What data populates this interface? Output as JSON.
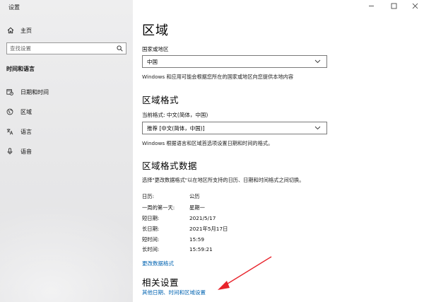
{
  "window": {
    "title": "设置",
    "controls": {
      "minimize": "—",
      "maximize": "□",
      "close": "✕"
    }
  },
  "sidebar": {
    "home_label": "主页",
    "search_placeholder": "查找设置",
    "section_title": "时间和语言",
    "items": [
      {
        "label": "日期和时间",
        "icon": "calendar-clock-icon"
      },
      {
        "label": "区域",
        "icon": "globe-icon",
        "active": true
      },
      {
        "label": "语言",
        "icon": "language-icon"
      },
      {
        "label": "语音",
        "icon": "microphone-icon"
      }
    ]
  },
  "main": {
    "title": "区域",
    "country": {
      "label": "国家或地区",
      "value": "中国",
      "description": "Windows 和应用可能会根据您所在的国家或地区向您提供本地内容"
    },
    "regional_format": {
      "heading": "区域格式",
      "current_label": "当前格式: 中文(简体，中国)",
      "value": "推荐 [中文(简体，中国)]",
      "description": "Windows 根据语言和区域首选项设置日期和时间的格式。"
    },
    "format_data": {
      "heading": "区域格式数据",
      "description": "选择\"更改数据格式\"以在地区所支持的日历、日期和时间格式之间切换。",
      "rows": [
        {
          "key": "日历:",
          "value": "公历"
        },
        {
          "key": "一周的第一天:",
          "value": "星期一"
        },
        {
          "key": "短日期:",
          "value": "2021/5/17"
        },
        {
          "key": "长日期:",
          "value": "2021年5月17日"
        },
        {
          "key": "短时间:",
          "value": "15:59"
        },
        {
          "key": "长时间:",
          "value": "15:59:21"
        }
      ],
      "change_link": "更改数据格式"
    },
    "related": {
      "heading": "相关设置",
      "link": "其他日期、时间和区域设置"
    }
  },
  "colors": {
    "accent": "#0063b1",
    "annotation_arrow": "#e8232b",
    "sidebar_bg": "#ececed"
  }
}
